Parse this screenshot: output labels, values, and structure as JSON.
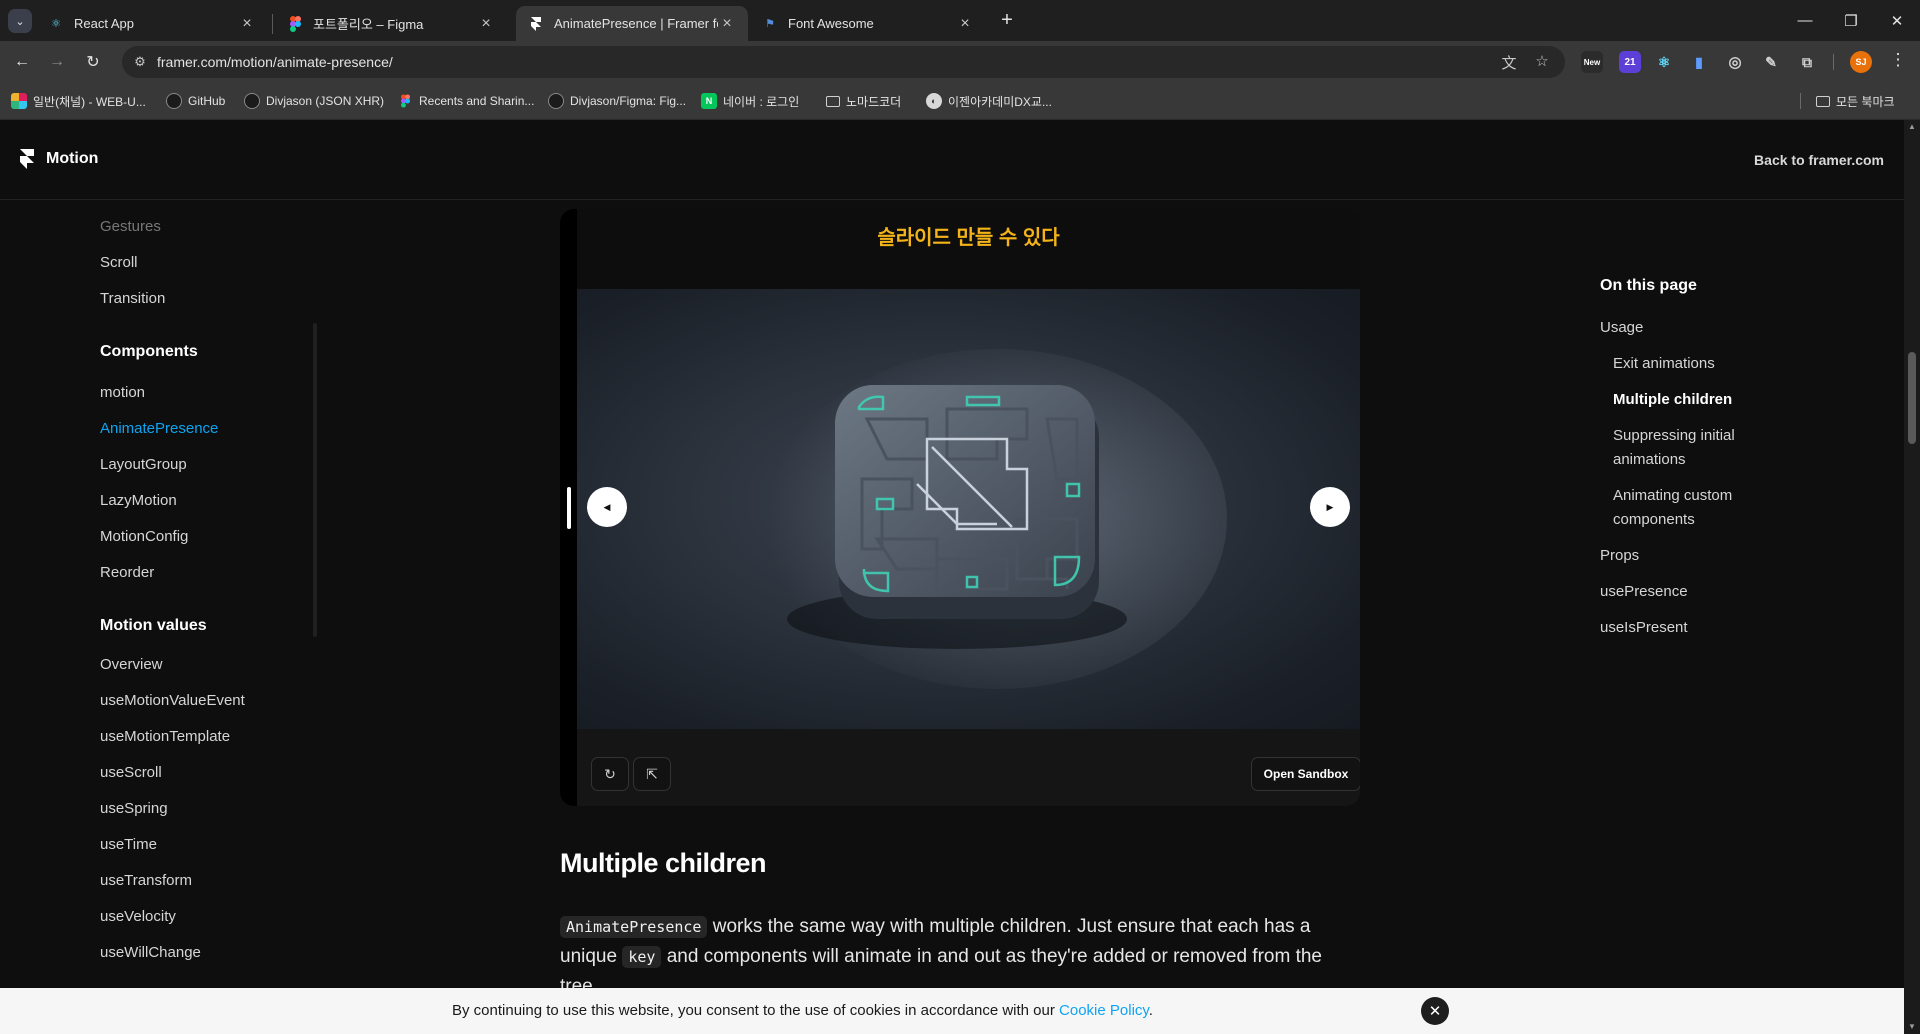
{
  "browser": {
    "tabs": [
      {
        "title": "React App",
        "icon": "react-icon"
      },
      {
        "title": "포트폴리오 – Figma",
        "icon": "figma-icon"
      },
      {
        "title": "AnimatePresence | Framer for",
        "icon": "framer-icon",
        "active": true
      },
      {
        "title": "Font Awesome",
        "icon": "flag-icon"
      }
    ],
    "url": "framer.com/motion/animate-presence/",
    "extension_badge": "21",
    "extension_new_label": "New",
    "profile_initials": "SJ",
    "bookmarks": [
      {
        "label": "일반(채널) - WEB-U...",
        "icon": "slack-icon"
      },
      {
        "label": "GitHub",
        "icon": "github-icon"
      },
      {
        "label": "Divjason (JSON XHR)",
        "icon": "github-icon"
      },
      {
        "label": "Recents and Sharin...",
        "icon": "figma-icon"
      },
      {
        "label": "Divjason/Figma: Fig...",
        "icon": "github-icon"
      },
      {
        "label": "네이버 : 로그인",
        "icon": "naver-icon",
        "badge": "N"
      },
      {
        "label": "노마드코더",
        "icon": "folder-icon"
      },
      {
        "label": "이젠아카데미DX교...",
        "icon": "globe-icon"
      }
    ],
    "all_bookmarks_label": "모든 북마크"
  },
  "header": {
    "logo_text": "Motion",
    "back_link": "Back to framer.com"
  },
  "sidebar": {
    "top_items": [
      "Gestures",
      "Scroll",
      "Transition"
    ],
    "components_heading": "Components",
    "components": [
      "motion",
      "AnimatePresence",
      "LayoutGroup",
      "LazyMotion",
      "MotionConfig",
      "Reorder"
    ],
    "active_item": "AnimatePresence",
    "motion_values_heading": "Motion values",
    "motion_values": [
      "Overview",
      "useMotionValueEvent",
      "useMotionTemplate",
      "useScroll",
      "useSpring",
      "useTime",
      "useTransform",
      "useVelocity",
      "useWillChange"
    ]
  },
  "demo": {
    "title": "슬라이드 만들 수 있다",
    "open_sandbox_label": "Open Sandbox"
  },
  "article": {
    "heading": "Multiple children",
    "code1": "AnimatePresence",
    "text1": " works the same way with multiple children. Just ensure that each has a unique ",
    "code2": "key",
    "text2": " and components will animate in and out as they're added or removed from the tree."
  },
  "toc": {
    "heading": "On this page",
    "items": [
      {
        "label": "Usage",
        "level": 1
      },
      {
        "label": "Exit animations",
        "level": 2
      },
      {
        "label": "Multiple children",
        "level": 2,
        "current": true
      },
      {
        "label": "Suppressing initial animations",
        "level": 2
      },
      {
        "label": "Animating custom components",
        "level": 2
      },
      {
        "label": "Props",
        "level": 1
      },
      {
        "label": "usePresence",
        "level": 1
      },
      {
        "label": "useIsPresent",
        "level": 1
      }
    ]
  },
  "cookie": {
    "message": "By continuing to use this website, you consent to the use of cookies in accordance with our ",
    "link": "Cookie Policy",
    "end": "."
  },
  "colors": {
    "accent": "#0fa4f2",
    "demo_title": "#f5b31a",
    "background": "#0e0e0e"
  }
}
